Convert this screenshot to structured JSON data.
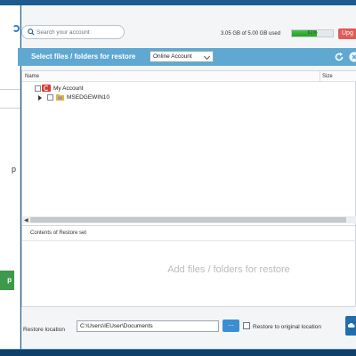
{
  "search": {
    "placeholder": "Search your account"
  },
  "quota": {
    "text": "3.05 GB of 5.00 GB used",
    "percent_label": "61%",
    "percent": 61,
    "fill_color": "#36b336"
  },
  "upgrade": {
    "label": "Upg"
  },
  "header": {
    "title": "Select files / folders for restore",
    "source_select": "Online Account",
    "bg_color": "#5fa8d1"
  },
  "tree": {
    "columns": {
      "name": "Name",
      "size": "Size"
    },
    "items": [
      {
        "label": "My Account",
        "icon": "account-icon"
      },
      {
        "label": "MSEDGEWIN10",
        "icon": "folder-icon"
      }
    ]
  },
  "contents": {
    "label": "Contents of Restore set",
    "placeholder": "Add files / folders for restore"
  },
  "restore_location": {
    "label": "Restore location",
    "value": "C:\\Users\\IEUser\\Documents",
    "browse_label": "...",
    "original_label": "Restore to original location"
  },
  "sidebar": {
    "fragment_letter": "p",
    "button_fragment": "p",
    "button_color": "#3e9a4a"
  }
}
